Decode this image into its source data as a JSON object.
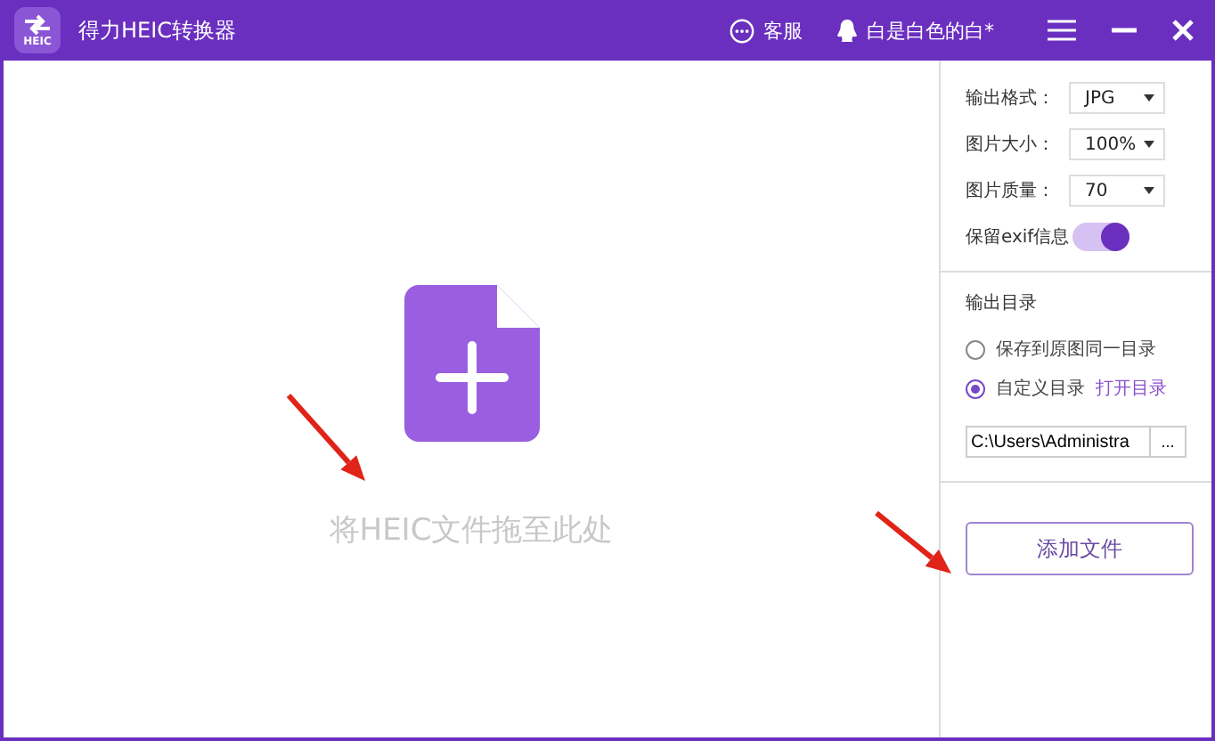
{
  "window": {
    "title": "得力HEIC转换器",
    "logo_text": "HEIC",
    "service": "客服",
    "user": "白是白色的白*"
  },
  "drop_zone": {
    "hint": "将HEIC文件拖至此处"
  },
  "settings": [
    {
      "kind": "select",
      "label": "输出格式：",
      "value": "JPG"
    },
    {
      "kind": "select",
      "label": "图片大小：",
      "value": "100%"
    },
    {
      "kind": "select",
      "label": "图片质量：",
      "value": "70"
    },
    {
      "kind": "toggle",
      "label": "保留exif信息",
      "on": true
    }
  ],
  "output": {
    "title": "输出目录",
    "options": [
      {
        "label": "保存到原图同一目录",
        "selected": false
      },
      {
        "label": "自定义目录",
        "selected": true
      }
    ],
    "open_link": "打开目录",
    "path": "C:\\Users\\Administra",
    "browse": "..."
  },
  "add_button": "添加文件"
}
